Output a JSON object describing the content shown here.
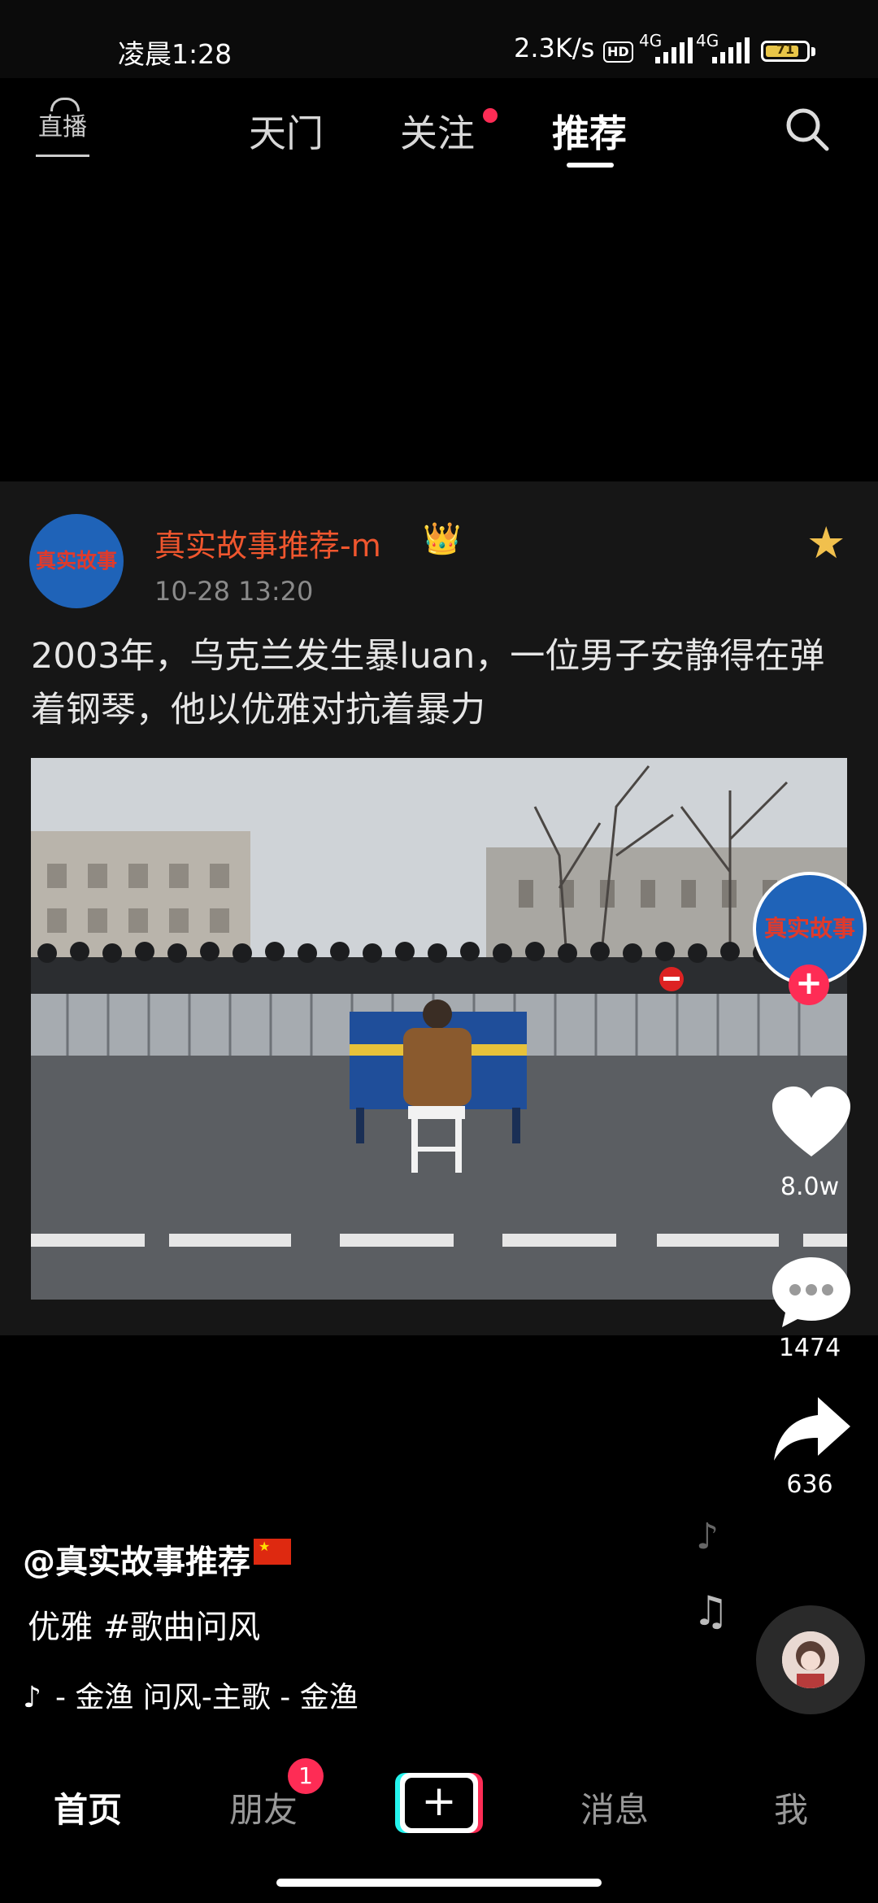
{
  "status_bar": {
    "time": "凌晨1:28",
    "net_speed": "2.3K/s",
    "hd_badge": "HD",
    "signal_1": "4G",
    "signal_2": "4G",
    "battery": "71"
  },
  "top_nav": {
    "live_label": "直播",
    "tabs": [
      {
        "label": "天门"
      },
      {
        "label": "关注"
      },
      {
        "label": "推荐",
        "active": true
      }
    ]
  },
  "post": {
    "avatar_text": "真实故事",
    "author": "真实故事推荐-m",
    "date": "10-28 13:20",
    "text": "2003年，乌克兰发生暴luan，一位男子安静得在弹着钢琴，他以优雅对抗着暴力"
  },
  "rail": {
    "creator_avatar_text": "真实故事",
    "likes": "8.0w",
    "comments": "1474",
    "shares": "636"
  },
  "video_info": {
    "username": "@真实故事推荐",
    "caption": "优雅 #歌曲问风",
    "music": "- 金渔    问风-主歌 - 金渔"
  },
  "bottom_tabs": {
    "home": "首页",
    "friends": "朋友",
    "friends_badge": "1",
    "create": "+",
    "messages": "消息",
    "me": "我"
  },
  "colors": {
    "accent": "#fe2c55",
    "author_name": "#f0562e",
    "avatar_blue": "#1f63b8"
  }
}
